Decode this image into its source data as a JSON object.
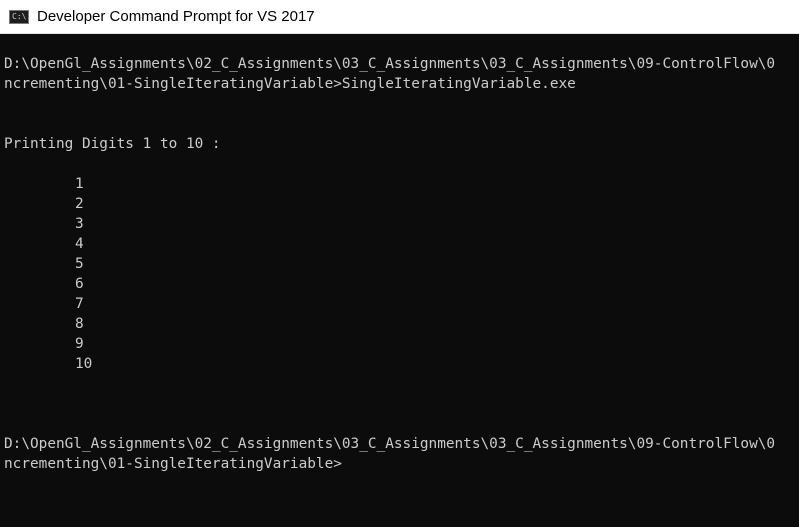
{
  "window": {
    "title": "Developer Command Prompt for VS 2017",
    "icon": "cmd-icon",
    "icon_text": "C:\\."
  },
  "console": {
    "path_line_1": "D:\\OpenGl_Assignments\\02_C_Assignments\\03_C_Assignments\\03_C_Assignments\\09-ControlFlow\\0",
    "command_line_2": "ncrementing\\01-SingleIteratingVariable>SingleIteratingVariable.exe",
    "header": "Printing Digits 1 to 10 :",
    "digits": [
      "1",
      "2",
      "3",
      "4",
      "5",
      "6",
      "7",
      "8",
      "9",
      "10"
    ],
    "prompt_line_1": "D:\\OpenGl_Assignments\\02_C_Assignments\\03_C_Assignments\\03_C_Assignments\\09-ControlFlow\\0",
    "prompt_line_2": "ncrementing\\01-SingleIteratingVariable>"
  },
  "colors": {
    "console_bg": "#0c0c0c",
    "console_fg": "#cccccc",
    "titlebar_bg": "#ffffff"
  }
}
